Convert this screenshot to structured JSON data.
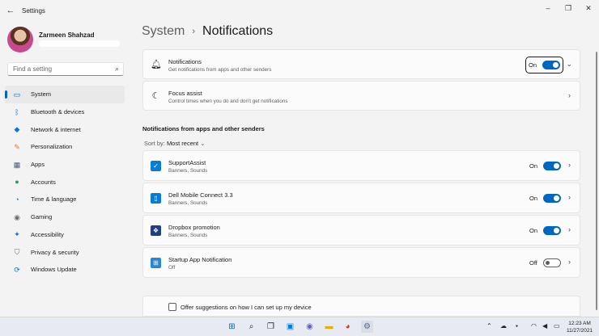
{
  "window": {
    "title": "Settings",
    "back_icon": "back-arrow-icon"
  },
  "user": {
    "name": "Zarmeen Shahzad"
  },
  "search": {
    "placeholder": "Find a setting"
  },
  "sidebar": {
    "items": [
      {
        "label": "System",
        "icon": "system-icon",
        "color": "#0067c0",
        "active": true
      },
      {
        "label": "Bluetooth & devices",
        "icon": "bluetooth-icon",
        "color": "#0078d4"
      },
      {
        "label": "Network & internet",
        "icon": "wifi-icon",
        "color": "#0078d4"
      },
      {
        "label": "Personalization",
        "icon": "brush-icon",
        "color": "#e3742f"
      },
      {
        "label": "Apps",
        "icon": "apps-icon",
        "color": "#4a5a75"
      },
      {
        "label": "Accounts",
        "icon": "accounts-icon",
        "color": "#2b9a5a"
      },
      {
        "label": "Time & language",
        "icon": "globe-clock-icon",
        "color": "#0078d4"
      },
      {
        "label": "Gaming",
        "icon": "gamepad-icon",
        "color": "#6b6b6b"
      },
      {
        "label": "Accessibility",
        "icon": "accessibility-icon",
        "color": "#1e6fcf"
      },
      {
        "label": "Privacy & security",
        "icon": "shield-icon",
        "color": "#6b6b6b"
      },
      {
        "label": "Windows Update",
        "icon": "update-icon",
        "color": "#0078d4"
      }
    ]
  },
  "breadcrumb": {
    "parent": "System",
    "separator": "›",
    "current": "Notifications"
  },
  "notifications_card": {
    "title": "Notifications",
    "subtitle": "Get notifications from apps and other senders",
    "state": "On",
    "enabled": true
  },
  "focus_card": {
    "title": "Focus assist",
    "subtitle": "Control times when you do and don't get notifications"
  },
  "section": {
    "heading": "Notifications from apps and other senders"
  },
  "sort": {
    "label": "Sort by:",
    "value": "Most recent"
  },
  "apps": [
    {
      "name": "SupportAssist",
      "sub": "Banners, Sounds",
      "state": "On",
      "enabled": true,
      "icon": "supportassist-icon",
      "color": "#0a7cd6"
    },
    {
      "name": "Dell Mobile Connect 3.3",
      "sub": "Banners, Sounds",
      "state": "On",
      "enabled": true,
      "icon": "dell-mobile-connect-icon",
      "color": "#0a7cd6"
    },
    {
      "name": "Dropbox promotion",
      "sub": "Banners, Sounds",
      "state": "On",
      "enabled": true,
      "icon": "dropbox-icon",
      "color": "#1f3f86"
    },
    {
      "name": "Startup App Notification",
      "sub": "Off",
      "state": "Off",
      "enabled": false,
      "icon": "startup-app-icon",
      "color": "#2a86d6"
    }
  ],
  "suggestions": {
    "label": "Offer suggestions on how I can set up my device",
    "checked": false
  },
  "taskbar": {
    "time": "12:23 AM",
    "date": "11/27/2021"
  },
  "colors": {
    "accent": "#0067c0",
    "background": "#f3f3f3",
    "card": "#fbfbfb"
  }
}
